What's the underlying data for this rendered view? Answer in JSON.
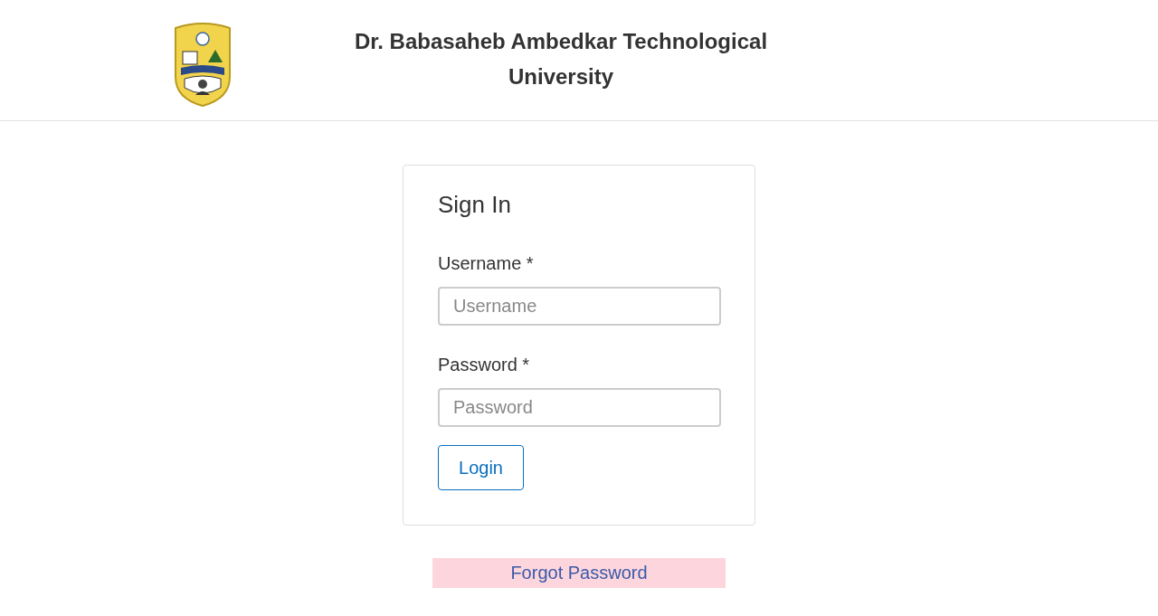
{
  "header": {
    "title": "Dr. Babasaheb Ambedkar Technological University"
  },
  "signin": {
    "heading": "Sign In",
    "fields": [
      {
        "label": "Username *",
        "placeholder": "Username"
      },
      {
        "label": "Password *",
        "placeholder": "Password"
      }
    ],
    "button": "Login"
  },
  "forgot_link": "Forgot Password"
}
